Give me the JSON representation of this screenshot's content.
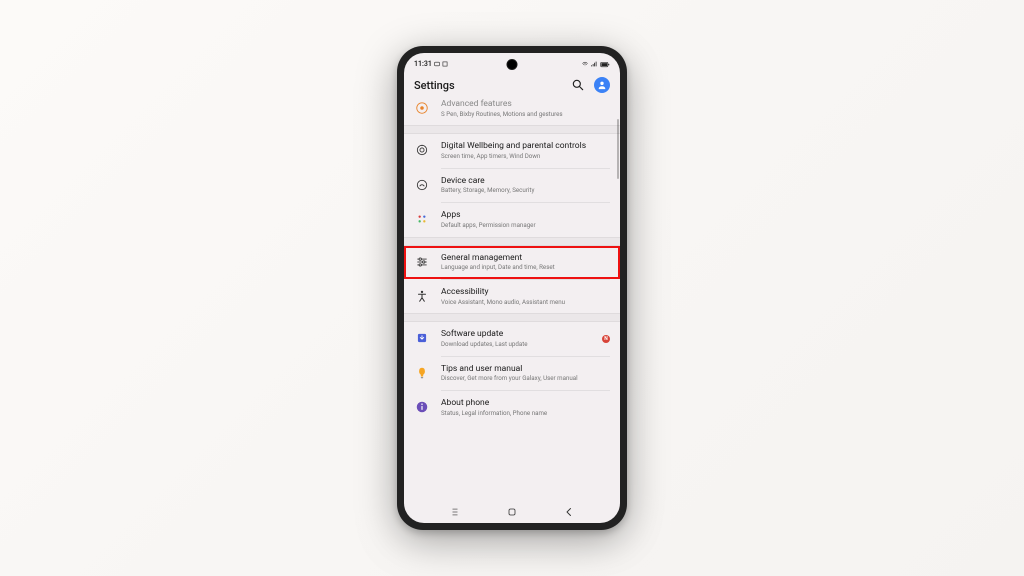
{
  "statusbar": {
    "time": "11:31"
  },
  "header": {
    "title": "Settings"
  },
  "items": [
    {
      "title": "Advanced features",
      "sub": "S Pen, Bixby Routines, Motions and gestures"
    },
    {
      "title": "Digital Wellbeing and parental controls",
      "sub": "Screen time, App timers, Wind Down"
    },
    {
      "title": "Device care",
      "sub": "Battery, Storage, Memory, Security"
    },
    {
      "title": "Apps",
      "sub": "Default apps, Permission manager"
    },
    {
      "title": "General management",
      "sub": "Language and input, Date and time, Reset"
    },
    {
      "title": "Accessibility",
      "sub": "Voice Assistant, Mono audio, Assistant menu"
    },
    {
      "title": "Software update",
      "sub": "Download updates, Last update"
    },
    {
      "title": "Tips and user manual",
      "sub": "Discover, Get more from your Galaxy, User manual"
    },
    {
      "title": "About phone",
      "sub": "Status, Legal information, Phone name"
    }
  ],
  "badge": {
    "software_update": "N"
  }
}
